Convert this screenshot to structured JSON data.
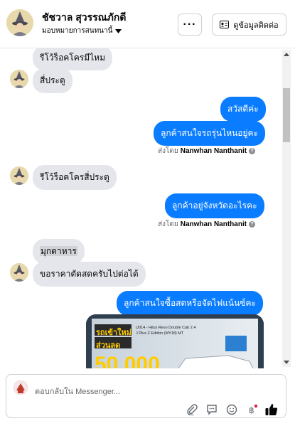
{
  "header": {
    "name": "ชัชวาล สุวรรณภักดี",
    "assign_label": "มอบหมายการสนทนานี้",
    "more_label": "···",
    "contact_button": "ดูข้อมูลติดต่อ"
  },
  "messages": [
    {
      "type": "incoming",
      "text": "รีโว้ร็อคโครมีไหม"
    },
    {
      "type": "incoming",
      "text": "สี่ประตู"
    },
    {
      "type": "outgoing",
      "text": "สวัสดีค่ะ"
    },
    {
      "type": "outgoing",
      "text": "ลูกค้าสนใจรถรุ่นไหนอยู่คะ"
    },
    {
      "type": "sentby",
      "prefix": "ส่งโดย",
      "name": "Nanwhan Nanthanit"
    },
    {
      "type": "incoming",
      "text": "รีโว้ร็อคโครสี่ประตู"
    },
    {
      "type": "outgoing",
      "text": "ลูกค้าอยู่จังหวัดอะไรคะ"
    },
    {
      "type": "sentby",
      "prefix": "ส่งโดย",
      "name": "Nanwhan Nanthanit"
    },
    {
      "type": "incoming",
      "text": "มุกดาหาร"
    },
    {
      "type": "incoming",
      "text": "ขอราคาตัดสดครับไปต่อได้"
    },
    {
      "type": "outgoing",
      "text": "ลูกค้าสนใจซื้อสดหรือจัดไฟแน้นซ์คะ"
    }
  ],
  "photo": {
    "headline": "รถเข้าใหม่",
    "subhead": "ส่วนลด",
    "amount": "50,000",
    "spec_line1": "U014 - Hilux Revo Double Cab 2.4",
    "spec_line2": "J Plus Z Edition (MY18) MT"
  },
  "composer": {
    "placeholder": "ตอบกลับใน Messenger..."
  },
  "colors": {
    "outgoing_bubble": "#0a7cff",
    "incoming_bubble": "#e4e6eb",
    "like": "#0a7cff"
  }
}
